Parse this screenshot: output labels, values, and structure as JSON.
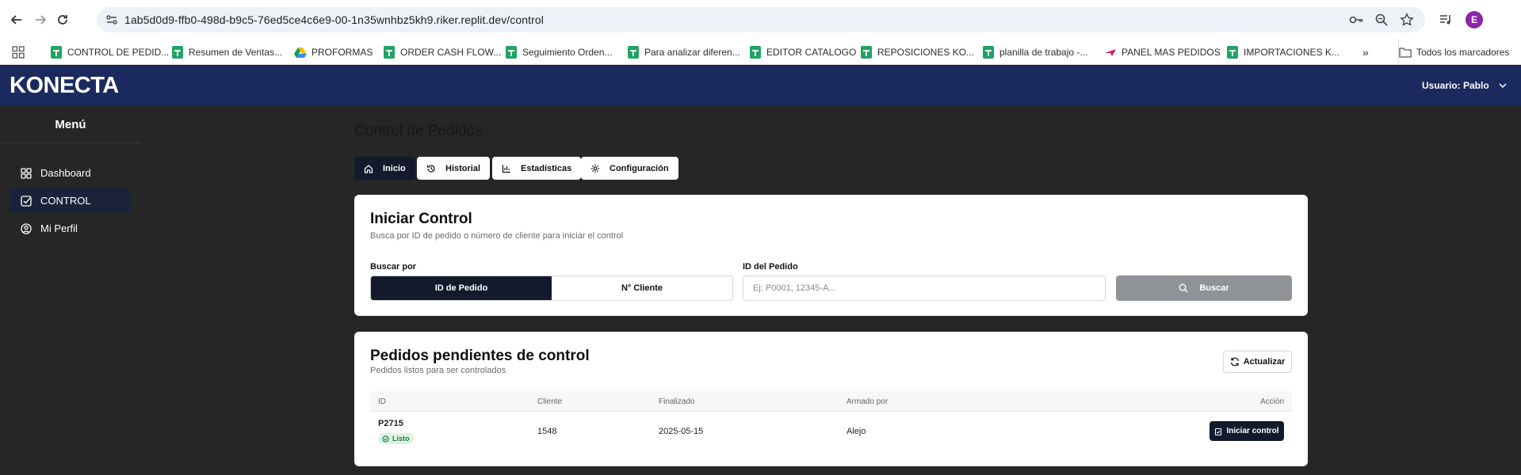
{
  "browser": {
    "url": "1ab5d0d9-ffb0-498d-b9c5-76ed5ce4c6e9-00-1n35wnhbz5kh9.riker.replit.dev/control",
    "profile_initial": "E",
    "bookmarks": [
      {
        "label": "CONTROL DE PEDID...",
        "icon": "sheets-icon"
      },
      {
        "label": "Resumen de Ventas...",
        "icon": "sheets-icon"
      },
      {
        "label": "PROFORMAS",
        "icon": "drive-icon"
      },
      {
        "label": "ORDER CASH FLOW...",
        "icon": "sheets-icon"
      },
      {
        "label": "Seguimiento Orden...",
        "icon": "sheets-icon"
      },
      {
        "label": "Para analizar diferen...",
        "icon": "sheets-icon"
      },
      {
        "label": "EDITOR CATALOGO",
        "icon": "sheets-icon"
      },
      {
        "label": "REPOSICIONES KO...",
        "icon": "sheets-icon"
      },
      {
        "label": "planilla de trabajo -...",
        "icon": "sheets-icon"
      },
      {
        "label": "PANEL MAS PEDIDOS",
        "icon": "plane-icon"
      },
      {
        "label": "IMPORTACIONES K...",
        "icon": "sheets-icon"
      }
    ],
    "all_bookmarks": "Todos los marcadores"
  },
  "app": {
    "logo": "KONECTA",
    "user": "Usuario: Pablo"
  },
  "sidebar": {
    "title": "Menú",
    "items": [
      {
        "label": "Dashboard",
        "icon": "grid-icon"
      },
      {
        "label": "CONTROL",
        "icon": "checkbox-icon"
      },
      {
        "label": "Mi Perfil",
        "icon": "user-circle-icon"
      }
    ]
  },
  "main": {
    "title": "Control de Pedidos",
    "tabs": [
      {
        "label": "Inicio",
        "icon": "home-icon"
      },
      {
        "label": "Historial",
        "icon": "history-icon"
      },
      {
        "label": "Estadísticas",
        "icon": "bar-chart-icon"
      },
      {
        "label": "Configuración",
        "icon": "gear-icon"
      }
    ]
  },
  "start_control": {
    "title": "Iniciar Control",
    "subtitle": "Busca por ID de pedido o número de cliente para iniciar el control",
    "search_by_label": "Buscar por",
    "options": [
      "ID de Pedido",
      "N° Cliente"
    ],
    "id_label": "ID del Pedido",
    "id_placeholder": "Ej: P0001, 12345-A...",
    "search_button": "Buscar"
  },
  "pending": {
    "title": "Pedidos pendientes de control",
    "subtitle": "Pedidos listos para ser controlados",
    "refresh_button": "Actualizar",
    "columns": [
      "ID",
      "Cliente",
      "Finalizado",
      "Armado por",
      "Acción"
    ],
    "rows": [
      {
        "id": "P2715",
        "status": "Listo",
        "cliente": "1548",
        "finalizado": "2025-05-15",
        "armado_por": "Alejo",
        "action": "Iniciar control"
      }
    ]
  }
}
